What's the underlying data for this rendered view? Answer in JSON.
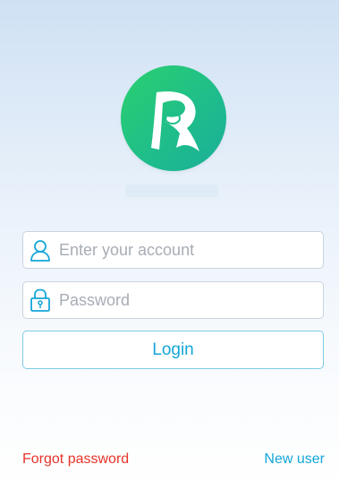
{
  "logo": {
    "icon": "r-ribbon-logo-icon",
    "colors": [
      "#2bd06d",
      "#1aae99"
    ]
  },
  "login_form": {
    "account_placeholder": "Enter your account",
    "account_icon": "user-icon",
    "password_placeholder": "Password",
    "password_icon": "lock-icon",
    "login_label": "Login"
  },
  "footer": {
    "forgot_label": "Forgot password",
    "new_user_label": "New user"
  },
  "colors": {
    "accent": "#14a6d8",
    "danger": "#e8332a",
    "placeholder": "#a7adb5"
  }
}
